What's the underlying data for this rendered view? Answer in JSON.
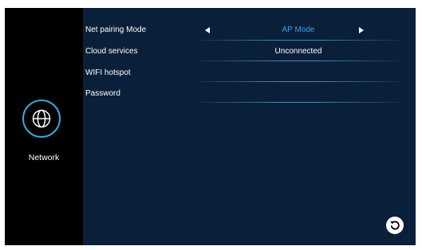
{
  "sidebar": {
    "icon": "globe-icon",
    "label": "Network"
  },
  "settings": [
    {
      "label": "Net pairing Mode",
      "value": "AP Mode",
      "value_color": "#3aa0e0",
      "has_arrows": true
    },
    {
      "label": "Cloud services",
      "value": "Unconnected",
      "value_color": "#ffffff",
      "has_arrows": false
    },
    {
      "label": "WIFI hotspot",
      "value": "",
      "value_color": "#ffffff",
      "has_arrows": false
    },
    {
      "label": "Password",
      "value": "",
      "value_color": "#ffffff",
      "has_arrows": false
    }
  ],
  "controls": {
    "prev_icon": "caret-left-icon",
    "next_icon": "caret-right-icon",
    "back_icon": "back-arrow-icon"
  },
  "colors": {
    "background": "#0a1f3a",
    "sidebar": "#000000",
    "accent": "#3aa0e0"
  }
}
